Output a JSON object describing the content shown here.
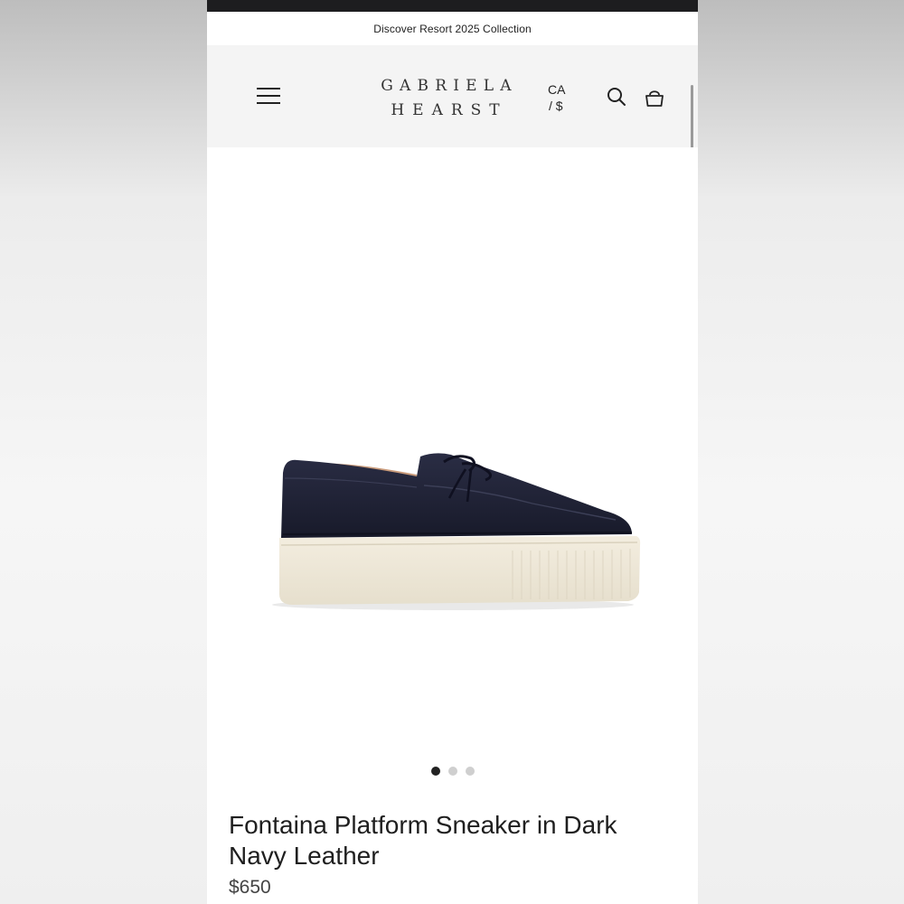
{
  "promo": {
    "text": "Discover Resort 2025 Collection"
  },
  "header": {
    "logo_line1": "GABRIELA",
    "logo_line2": "HEARST",
    "currency_line1": "CA",
    "currency_line2": "/ $",
    "icons": [
      "menu-icon",
      "search-icon",
      "shopping-bag-icon"
    ]
  },
  "gallery": {
    "total_images": 3,
    "active_index": 1
  },
  "product": {
    "title": "Fontaina Platform Sneaker in Dark Navy Leather",
    "price": "$650"
  },
  "colors": {
    "leather": "#1f2235",
    "sole": "#efe8d8",
    "header_bg": "#f4f4f4",
    "status_bar": "#1d1d1f"
  }
}
